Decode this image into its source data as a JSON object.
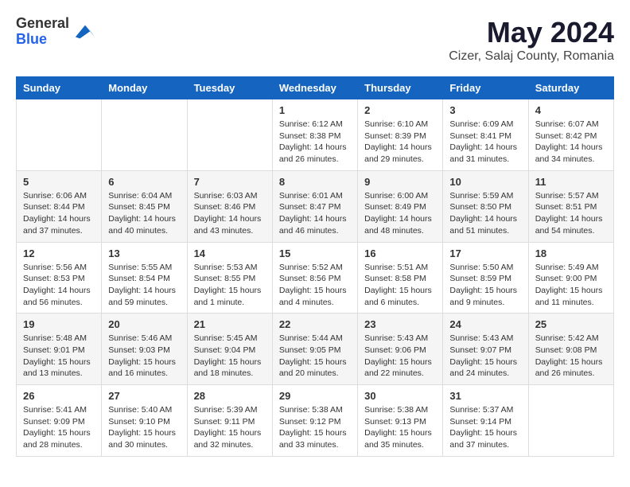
{
  "header": {
    "logo_general": "General",
    "logo_blue": "Blue",
    "month_title": "May 2024",
    "location": "Cizer, Salaj County, Romania"
  },
  "weekdays": [
    "Sunday",
    "Monday",
    "Tuesday",
    "Wednesday",
    "Thursday",
    "Friday",
    "Saturday"
  ],
  "weeks": [
    [
      {
        "day": "",
        "info": ""
      },
      {
        "day": "",
        "info": ""
      },
      {
        "day": "",
        "info": ""
      },
      {
        "day": "1",
        "info": "Sunrise: 6:12 AM\nSunset: 8:38 PM\nDaylight: 14 hours\nand 26 minutes."
      },
      {
        "day": "2",
        "info": "Sunrise: 6:10 AM\nSunset: 8:39 PM\nDaylight: 14 hours\nand 29 minutes."
      },
      {
        "day": "3",
        "info": "Sunrise: 6:09 AM\nSunset: 8:41 PM\nDaylight: 14 hours\nand 31 minutes."
      },
      {
        "day": "4",
        "info": "Sunrise: 6:07 AM\nSunset: 8:42 PM\nDaylight: 14 hours\nand 34 minutes."
      }
    ],
    [
      {
        "day": "5",
        "info": "Sunrise: 6:06 AM\nSunset: 8:44 PM\nDaylight: 14 hours\nand 37 minutes."
      },
      {
        "day": "6",
        "info": "Sunrise: 6:04 AM\nSunset: 8:45 PM\nDaylight: 14 hours\nand 40 minutes."
      },
      {
        "day": "7",
        "info": "Sunrise: 6:03 AM\nSunset: 8:46 PM\nDaylight: 14 hours\nand 43 minutes."
      },
      {
        "day": "8",
        "info": "Sunrise: 6:01 AM\nSunset: 8:47 PM\nDaylight: 14 hours\nand 46 minutes."
      },
      {
        "day": "9",
        "info": "Sunrise: 6:00 AM\nSunset: 8:49 PM\nDaylight: 14 hours\nand 48 minutes."
      },
      {
        "day": "10",
        "info": "Sunrise: 5:59 AM\nSunset: 8:50 PM\nDaylight: 14 hours\nand 51 minutes."
      },
      {
        "day": "11",
        "info": "Sunrise: 5:57 AM\nSunset: 8:51 PM\nDaylight: 14 hours\nand 54 minutes."
      }
    ],
    [
      {
        "day": "12",
        "info": "Sunrise: 5:56 AM\nSunset: 8:53 PM\nDaylight: 14 hours\nand 56 minutes."
      },
      {
        "day": "13",
        "info": "Sunrise: 5:55 AM\nSunset: 8:54 PM\nDaylight: 14 hours\nand 59 minutes."
      },
      {
        "day": "14",
        "info": "Sunrise: 5:53 AM\nSunset: 8:55 PM\nDaylight: 15 hours\nand 1 minute."
      },
      {
        "day": "15",
        "info": "Sunrise: 5:52 AM\nSunset: 8:56 PM\nDaylight: 15 hours\nand 4 minutes."
      },
      {
        "day": "16",
        "info": "Sunrise: 5:51 AM\nSunset: 8:58 PM\nDaylight: 15 hours\nand 6 minutes."
      },
      {
        "day": "17",
        "info": "Sunrise: 5:50 AM\nSunset: 8:59 PM\nDaylight: 15 hours\nand 9 minutes."
      },
      {
        "day": "18",
        "info": "Sunrise: 5:49 AM\nSunset: 9:00 PM\nDaylight: 15 hours\nand 11 minutes."
      }
    ],
    [
      {
        "day": "19",
        "info": "Sunrise: 5:48 AM\nSunset: 9:01 PM\nDaylight: 15 hours\nand 13 minutes."
      },
      {
        "day": "20",
        "info": "Sunrise: 5:46 AM\nSunset: 9:03 PM\nDaylight: 15 hours\nand 16 minutes."
      },
      {
        "day": "21",
        "info": "Sunrise: 5:45 AM\nSunset: 9:04 PM\nDaylight: 15 hours\nand 18 minutes."
      },
      {
        "day": "22",
        "info": "Sunrise: 5:44 AM\nSunset: 9:05 PM\nDaylight: 15 hours\nand 20 minutes."
      },
      {
        "day": "23",
        "info": "Sunrise: 5:43 AM\nSunset: 9:06 PM\nDaylight: 15 hours\nand 22 minutes."
      },
      {
        "day": "24",
        "info": "Sunrise: 5:43 AM\nSunset: 9:07 PM\nDaylight: 15 hours\nand 24 minutes."
      },
      {
        "day": "25",
        "info": "Sunrise: 5:42 AM\nSunset: 9:08 PM\nDaylight: 15 hours\nand 26 minutes."
      }
    ],
    [
      {
        "day": "26",
        "info": "Sunrise: 5:41 AM\nSunset: 9:09 PM\nDaylight: 15 hours\nand 28 minutes."
      },
      {
        "day": "27",
        "info": "Sunrise: 5:40 AM\nSunset: 9:10 PM\nDaylight: 15 hours\nand 30 minutes."
      },
      {
        "day": "28",
        "info": "Sunrise: 5:39 AM\nSunset: 9:11 PM\nDaylight: 15 hours\nand 32 minutes."
      },
      {
        "day": "29",
        "info": "Sunrise: 5:38 AM\nSunset: 9:12 PM\nDaylight: 15 hours\nand 33 minutes."
      },
      {
        "day": "30",
        "info": "Sunrise: 5:38 AM\nSunset: 9:13 PM\nDaylight: 15 hours\nand 35 minutes."
      },
      {
        "day": "31",
        "info": "Sunrise: 5:37 AM\nSunset: 9:14 PM\nDaylight: 15 hours\nand 37 minutes."
      },
      {
        "day": "",
        "info": ""
      }
    ]
  ]
}
